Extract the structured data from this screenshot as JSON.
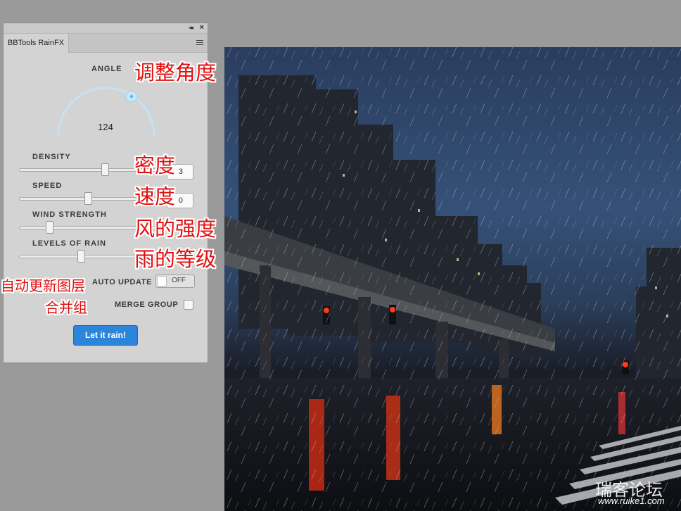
{
  "panel": {
    "tab_title": "BBTools RainFX",
    "collapse_glyph": "◂◂",
    "close_glyph": "×",
    "angle": {
      "label": "ANGLE",
      "value": "124"
    },
    "sliders": [
      {
        "label": "DENSITY",
        "value": "3",
        "level": 0.7
      },
      {
        "label": "SPEED",
        "value": "0",
        "level": 0.5
      },
      {
        "label": "WIND STRENGTH",
        "value": "",
        "level": 0.2
      },
      {
        "label": "LEVELS OF RAIN",
        "value": "",
        "level": 0.48
      }
    ],
    "auto_update": {
      "label": "AUTO UPDATE",
      "state": "OFF"
    },
    "merge_group": {
      "label": "MERGE GROUP",
      "checked": false
    },
    "action_button": "Let it rain!"
  },
  "annotations": {
    "angle": "调整角度",
    "density": "密度",
    "speed": "速度",
    "wind": "风的强度",
    "levels": "雨的等级",
    "auto_update": "自动更新图层",
    "merge": "合并组"
  },
  "watermark": {
    "text": "瑞客论坛",
    "url": "www.ruike1.com"
  },
  "colors": {
    "button": "#2b86d9",
    "dial_arc": "#bfe0f5",
    "annotation": "#e01010"
  }
}
